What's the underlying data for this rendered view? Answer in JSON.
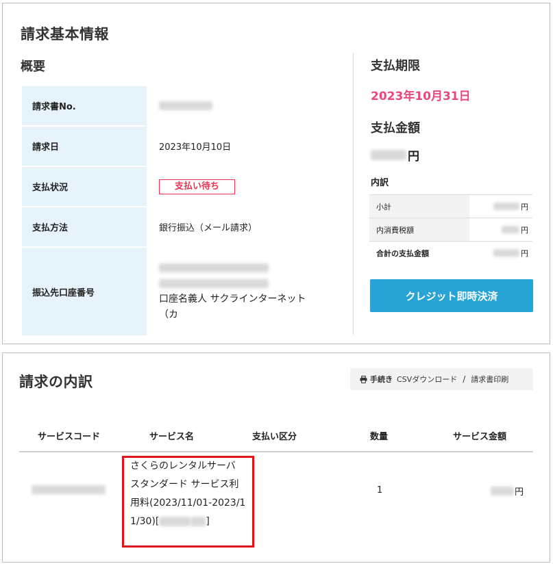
{
  "billing_info": {
    "title": "請求基本情報",
    "overview_heading": "概要",
    "rows": [
      {
        "label": "請求書No.",
        "value": "[redacted]"
      },
      {
        "label": "請求日",
        "value": "2023年10月10日"
      },
      {
        "label": "支払状況",
        "value": "支払い待ち"
      },
      {
        "label": "支払方法",
        "value": "銀行振込（メール請求）"
      },
      {
        "label": "振込先口座番号",
        "value_line1": "[redacted]",
        "value_line2": "[redacted]",
        "value_line3": "口座名義人 サクラインターネット",
        "value_line4": "（カ"
      }
    ]
  },
  "payment": {
    "due_heading": "支払期限",
    "due_date": "2023年10月31日",
    "amount_heading": "支払金額",
    "amount_suffix": "円",
    "breakdown_label": "内訳",
    "breakdown_rows": [
      {
        "label": "小計",
        "suffix": "円"
      },
      {
        "label": "内消費税額",
        "suffix": "円"
      },
      {
        "label": "合計の支払金額",
        "suffix": "円"
      }
    ],
    "credit_button": "クレジット即時決済"
  },
  "details": {
    "title": "請求の内訳",
    "actions": {
      "procedure": "手続き",
      "csv": "CSVダウンロード",
      "separator": "/",
      "print": "請求書印刷"
    },
    "columns": [
      "サービスコード",
      "サービス名",
      "支払い区分",
      "数量",
      "サービス金額"
    ],
    "rows": [
      {
        "service_code": "[redacted]",
        "service_name_prefix": "さくらのレンタルサーバ スタンダード サービス利用料(2023/11/01-2023/11/30)[",
        "service_name_suffix": "]",
        "payment_type": "",
        "quantity": "1",
        "amount_suffix": "円"
      }
    ]
  },
  "colors": {
    "accent_blue": "#27a3d6",
    "label_bg": "#e6f3fb",
    "status_red": "#e8344f",
    "due_pink": "#e8487a",
    "highlight_red": "#e0141c"
  }
}
